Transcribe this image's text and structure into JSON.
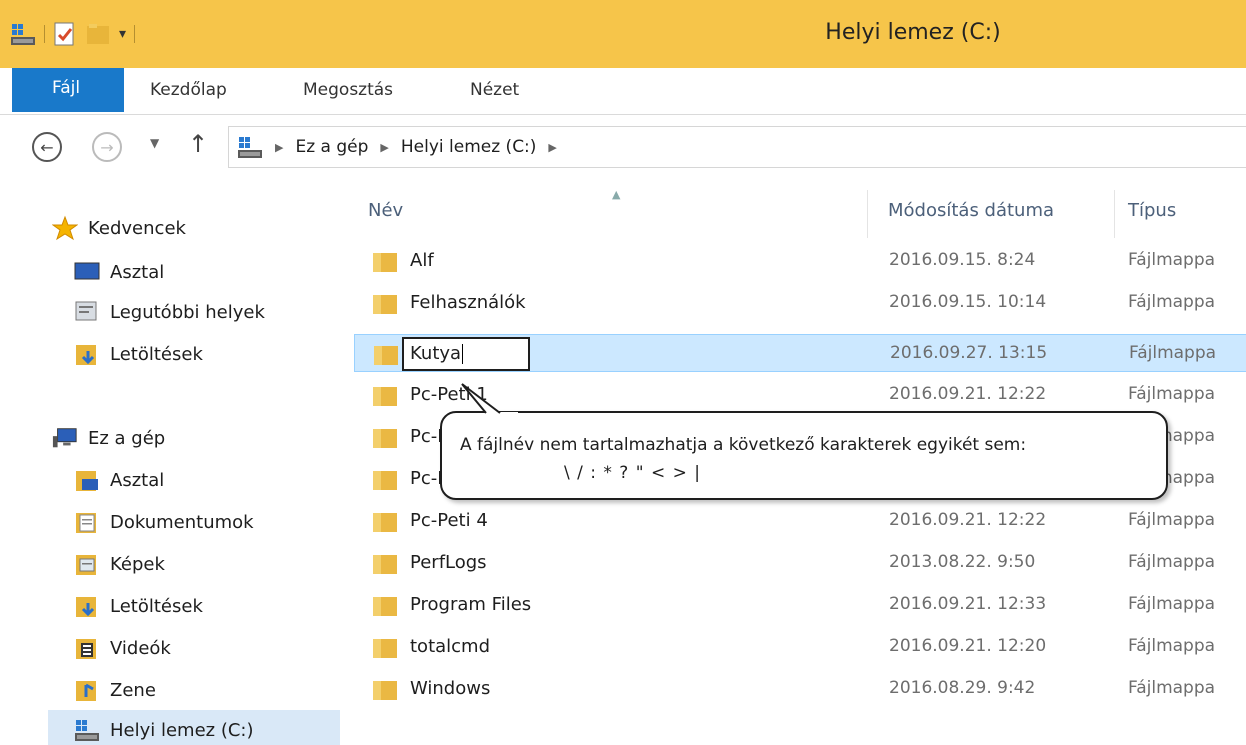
{
  "window": {
    "title": "Helyi lemez (C:)"
  },
  "ribbon": {
    "tabs": [
      "Fájl",
      "Kezdőlap",
      "Megosztás",
      "Nézet"
    ]
  },
  "address": {
    "crumbs": [
      "Ez a gép",
      "Helyi lemez (C:)"
    ]
  },
  "sidebar": {
    "favorites": {
      "label": "Kedvencek",
      "items": [
        "Asztal",
        "Legutóbbi helyek",
        "Letöltések"
      ]
    },
    "pc": {
      "label": "Ez a gép",
      "items": [
        "Asztal",
        "Dokumentumok",
        "Képek",
        "Letöltések",
        "Videók",
        "Zene",
        "Helyi lemez (C:)"
      ]
    }
  },
  "columns": {
    "name": "Név",
    "date": "Módosítás dátuma",
    "type": "Típus"
  },
  "files": [
    {
      "name": "Alf",
      "date": "2016.09.15. 8:24",
      "type": "Fájlmappa"
    },
    {
      "name": "Felhasználók",
      "date": "2016.09.15. 10:14",
      "type": "Fájlmappa"
    },
    {
      "name": "Kutya",
      "date": "2016.09.27. 13:15",
      "type": "Fájlmappa"
    },
    {
      "name": "Pc-Peti 1",
      "date": "2016.09.21. 12:22",
      "type": "Fájlmappa"
    },
    {
      "name": "Pc-Peti 2",
      "date": "",
      "type": "Fájlmappa"
    },
    {
      "name": "Pc-Peti 3",
      "date": "",
      "type": "Fájlmappa"
    },
    {
      "name": "Pc-Peti 4",
      "date": "2016.09.21. 12:22",
      "type": "Fájlmappa"
    },
    {
      "name": "PerfLogs",
      "date": "2013.08.22. 9:50",
      "type": "Fájlmappa"
    },
    {
      "name": "Program Files",
      "date": "2016.09.21. 12:33",
      "type": "Fájlmappa"
    },
    {
      "name": "totalcmd",
      "date": "2016.09.21. 12:20",
      "type": "Fájlmappa"
    },
    {
      "name": "Windows",
      "date": "2016.08.29. 9:42",
      "type": "Fájlmappa"
    }
  ],
  "tooltip": {
    "line1": "A fájlnév nem tartalmazhatja a következő karakterek egyikét sem:",
    "line2": "\\ / : * ? \" < > |"
  },
  "colors": {
    "titlebar": "#f6c54a",
    "file_tab": "#1979ca",
    "selection": "#cce8ff"
  }
}
